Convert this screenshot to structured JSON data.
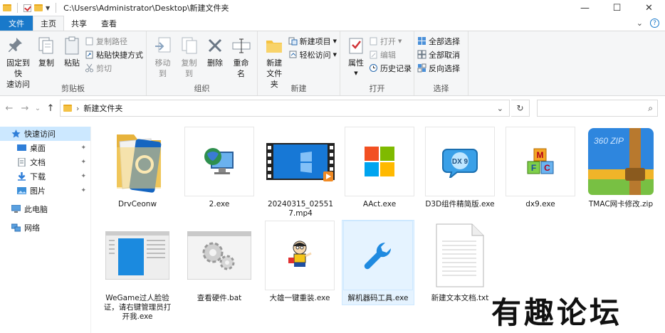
{
  "window": {
    "path": "C:\\Users\\Administrator\\Desktop\\新建文件夹",
    "minimize": "—",
    "maximize": "☐",
    "close": "✕"
  },
  "tabs": {
    "file": "文件",
    "home": "主页",
    "share": "共享",
    "view": "查看",
    "collapse": "⌄",
    "help": "?"
  },
  "ribbon": {
    "clipboard": {
      "label": "剪贴板",
      "pin": "固定到快",
      "pin2": "速访问",
      "copy": "复制",
      "paste": "粘贴",
      "copy_path": "复制路径",
      "paste_shortcut": "粘贴快捷方式",
      "cut": "剪切"
    },
    "organize": {
      "label": "组织",
      "move_to": "移动到",
      "copy_to": "复制到",
      "delete": "删除",
      "rename": "重命名"
    },
    "new": {
      "label": "新建",
      "new_folder": "新建",
      "new_folder2": "文件夹",
      "new_item": "新建项目",
      "easy_access": "轻松访问"
    },
    "open": {
      "label": "打开",
      "properties": "属性",
      "open": "打开",
      "edit": "编辑",
      "history": "历史记录"
    },
    "select": {
      "label": "选择",
      "select_all": "全部选择",
      "select_none": "全部取消",
      "invert": "反向选择"
    }
  },
  "address": {
    "back": "←",
    "forward": "→",
    "recent": "⌄",
    "up": "↑",
    "separator": "›",
    "crumb": "新建文件夹",
    "dropdown": "⌄",
    "refresh": "↻",
    "search_icon": "⌕"
  },
  "nav": {
    "quick_access": "快速访问",
    "desktop": "桌面",
    "documents": "文档",
    "downloads": "下载",
    "pictures": "图片",
    "this_pc": "此电脑",
    "network": "网络",
    "pin": "📌"
  },
  "files": [
    {
      "name": "DrvCeonw"
    },
    {
      "name": "2.exe"
    },
    {
      "name": "20240315_025517.mp4"
    },
    {
      "name": "AAct.exe"
    },
    {
      "name": "D3D组件精简版.exe"
    },
    {
      "name": "dx9.exe"
    },
    {
      "name": "TMAC网卡修改.zip"
    },
    {
      "name": "WeGame过人脸验证，请右键管理员打开我.exe"
    },
    {
      "name": "查看硬件.bat"
    },
    {
      "name": "大雄一键重装.exe"
    },
    {
      "name": "解机器码工具.exe"
    },
    {
      "name": "新建文本文档.txt"
    }
  ],
  "zip_badge": "360 ZIP",
  "dx_badge": "DX 9",
  "blocks_letters": [
    "M",
    "F",
    "C"
  ],
  "watermark": "有趣论坛",
  "colors": {
    "accent": "#1979ca",
    "selection": "#cce8ff"
  }
}
